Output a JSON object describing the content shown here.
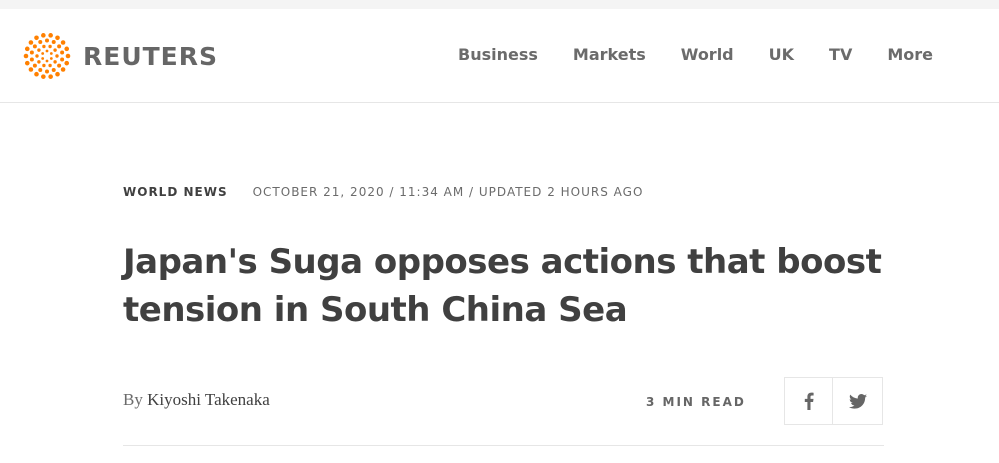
{
  "header": {
    "logo_text": "REUTERS",
    "nav": [
      {
        "label": "Business"
      },
      {
        "label": "Markets"
      },
      {
        "label": "World"
      },
      {
        "label": "UK"
      },
      {
        "label": "TV"
      },
      {
        "label": "More"
      }
    ]
  },
  "article": {
    "section": "WORLD NEWS",
    "dateline": "OCTOBER 21, 2020 / 11:34 AM / UPDATED 2 HOURS AGO",
    "headline": "Japan's Suga opposes actions that boost tension in South China Sea",
    "byline_prefix": "By",
    "author": "Kiyoshi Takenaka",
    "read_time": "3 MIN READ"
  },
  "share": {
    "buttons": [
      {
        "icon": "facebook-icon"
      },
      {
        "icon": "twitter-icon"
      }
    ]
  },
  "colors": {
    "logo_orange": "#ff8000",
    "text_dark": "#404040",
    "text_grey": "#6b6b6b",
    "border": "#e6e6e6"
  }
}
